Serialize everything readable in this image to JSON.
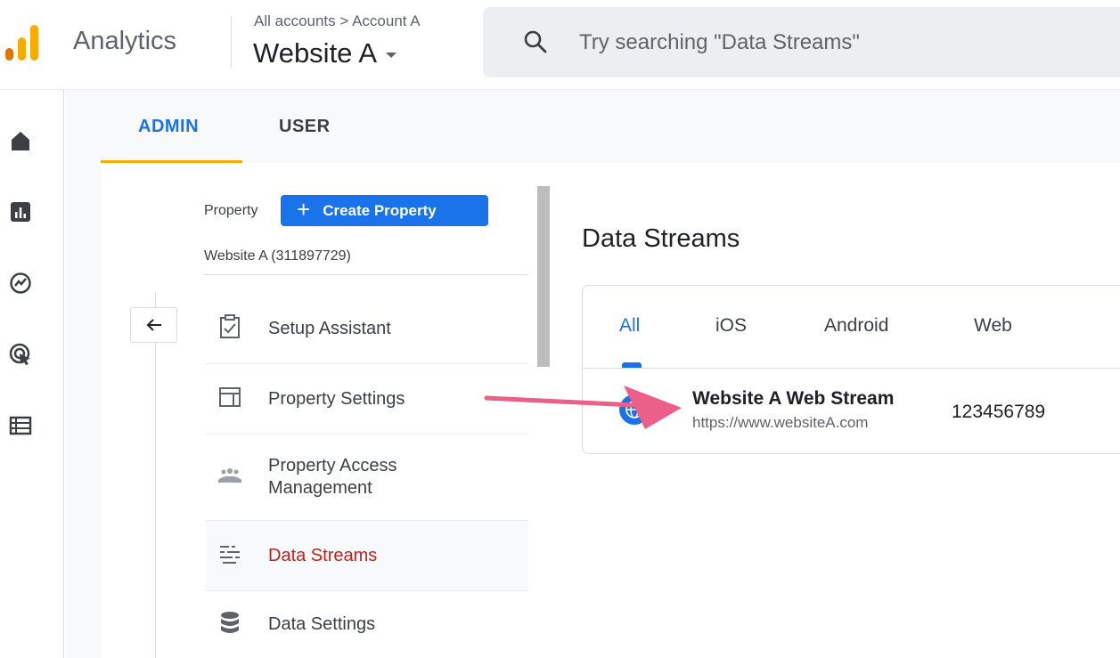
{
  "app": {
    "name": "Analytics",
    "breadcrumb": "All accounts > Account A",
    "account_title": "Website A"
  },
  "search": {
    "placeholder": "Try searching \"Data Streams\""
  },
  "left_nav": {
    "icons": [
      "home-icon",
      "reports-icon",
      "explore-icon",
      "advertising-icon",
      "configure-icon"
    ]
  },
  "tabs": {
    "admin": "ADMIN",
    "user": "USER"
  },
  "property": {
    "label": "Property",
    "create_button": "Create Property",
    "name": "Website A (311897729)"
  },
  "menu": {
    "items": [
      {
        "label": "Setup Assistant",
        "icon": "clipboard-check-icon"
      },
      {
        "label": "Property Settings",
        "icon": "layout-icon"
      },
      {
        "label": "Property Access Management",
        "icon": "people-icon"
      },
      {
        "label": "Data Streams",
        "icon": "data-streams-icon",
        "active": true
      },
      {
        "label": "Data Settings",
        "icon": "database-icon"
      }
    ]
  },
  "data_streams": {
    "title": "Data Streams",
    "filter_tabs": [
      "All",
      "iOS",
      "Android",
      "Web"
    ],
    "active_filter": "All",
    "streams": [
      {
        "name": "Website A Web Stream",
        "url": "https://www.websiteA.com",
        "id": "123456789",
        "icon": "globe-icon"
      }
    ]
  },
  "colors": {
    "accent_blue": "#1a73e8",
    "active_red": "#c5221f",
    "tab_underline": "#f9ab00",
    "annotation_arrow": "#ec5f88"
  }
}
